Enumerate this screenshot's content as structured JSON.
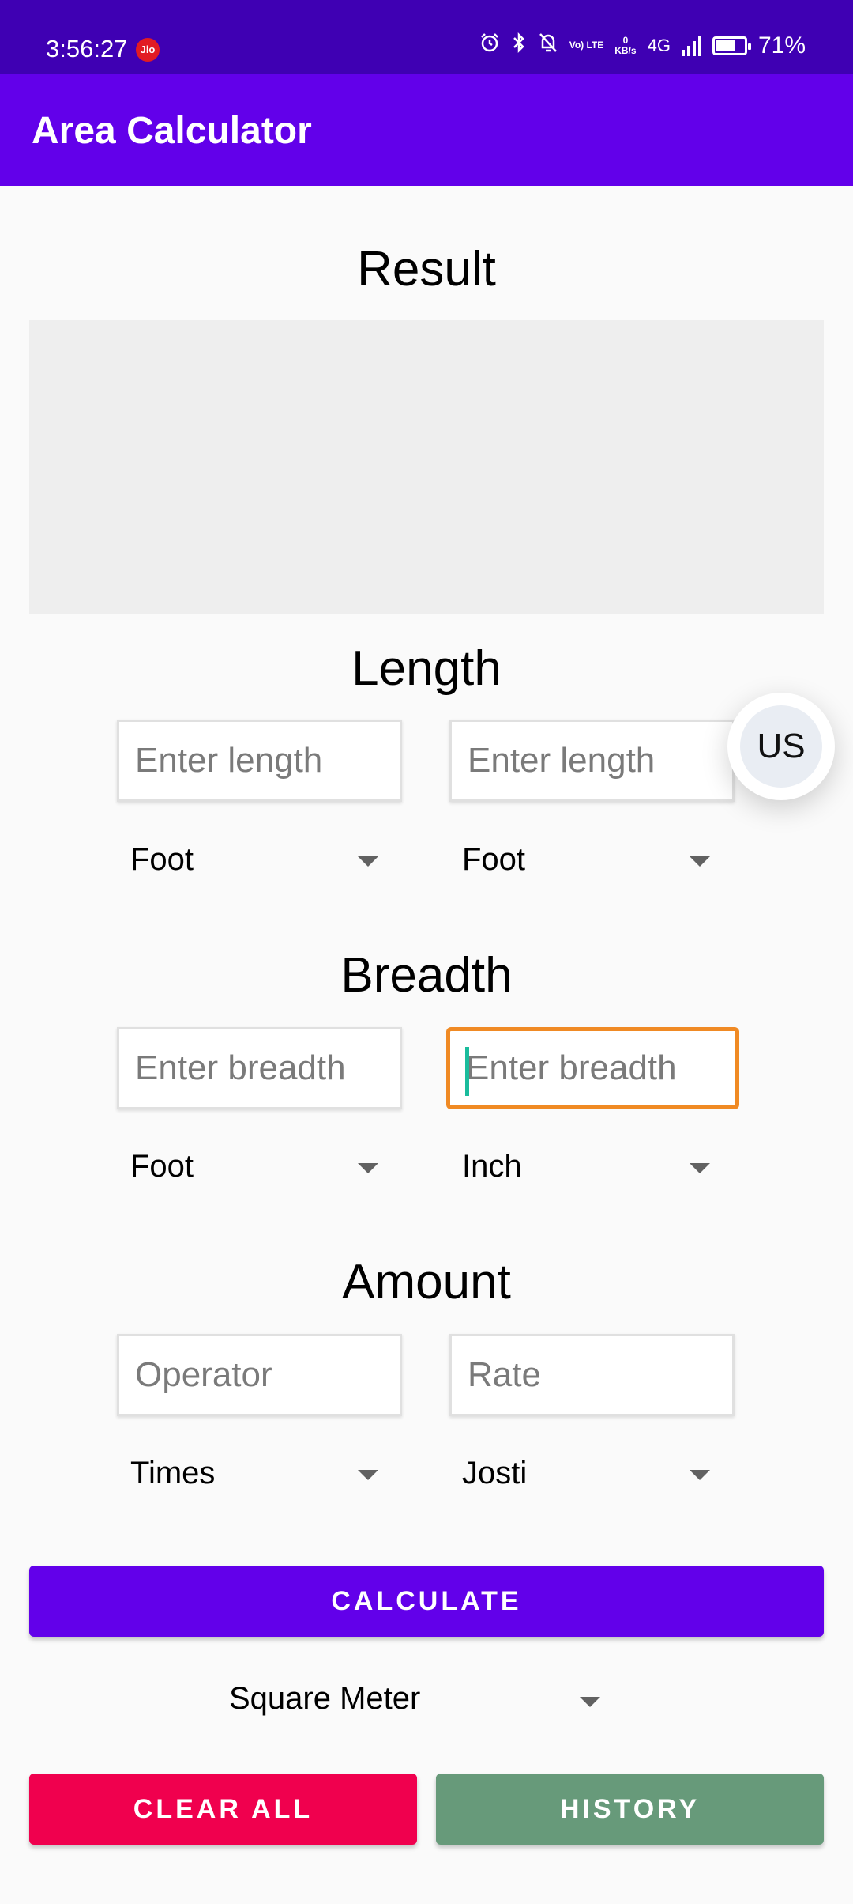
{
  "status_bar": {
    "time": "3:56:27",
    "carrier_badge": "Jio",
    "volte_label": "Vo) LTE",
    "data_speed_value": "0",
    "data_speed_unit": "KB/s",
    "network": "4G",
    "battery_percent": "71%",
    "battery_level": 0.71,
    "icons": [
      "alarm-icon",
      "bluetooth-icon",
      "mute-icon",
      "volte-icon",
      "data-speed",
      "network-4g",
      "signal-icon",
      "battery-icon"
    ]
  },
  "app_bar": {
    "title": "Area Calculator"
  },
  "result": {
    "heading": "Result",
    "value": ""
  },
  "length": {
    "heading": "Length",
    "input1_placeholder": "Enter length",
    "input2_placeholder": "Enter length",
    "unit1": "Foot",
    "unit2": "Foot"
  },
  "breadth": {
    "heading": "Breadth",
    "input1_placeholder": "Enter breadth",
    "input2_placeholder": "Enter breadth",
    "unit1": "Foot",
    "unit2": "Inch"
  },
  "amount": {
    "heading": "Amount",
    "operator_placeholder": "Operator",
    "rate_placeholder": "Rate",
    "operator_unit": "Times",
    "rate_unit": "Josti"
  },
  "fab": {
    "label": "US"
  },
  "actions": {
    "calculate_label": "CALCULATE",
    "result_unit": "Square Meter",
    "clear_label": "CLEAR ALL",
    "history_label": "HISTORY"
  },
  "colors": {
    "status_bar": "#3f00b3",
    "primary": "#6200ea",
    "clear_button": "#f0004e",
    "history_button": "#679a7a",
    "focus_border": "#f08a24",
    "cursor": "#1abc9c"
  }
}
